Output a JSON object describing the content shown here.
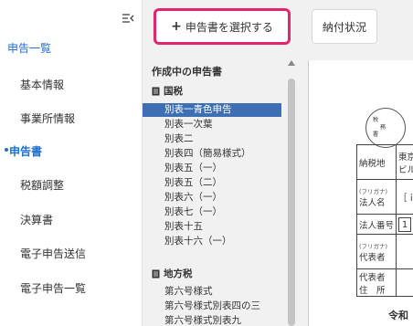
{
  "sidebar": {
    "collapse_icon": "collapse-left-icon",
    "title": "申告一覧",
    "items": [
      {
        "label": "基本情報",
        "active": false
      },
      {
        "label": "事業所情報",
        "active": false
      },
      {
        "label": "申告書",
        "active": true
      },
      {
        "label": "税額調整",
        "active": false
      },
      {
        "label": "決算書",
        "active": false
      },
      {
        "label": "電子申告送信",
        "active": false
      },
      {
        "label": "電子申告一覧",
        "active": false
      }
    ]
  },
  "middle": {
    "select_button": {
      "icon": "plus-icon",
      "label": "申告書を選択する",
      "border_color": "#e2266e"
    },
    "section_title": "作成中の申告書",
    "national_tax": {
      "label": "国税",
      "forms": [
        "別表一青色申告",
        "別表一次葉",
        "別表二",
        "別表四（簡易様式）",
        "別表五（一）",
        "別表五（二）",
        "別表六（一）",
        "別表七（一）",
        "別表十五",
        "別表十六（一）"
      ],
      "selected_index": 0
    },
    "local_tax": {
      "label": "地方税",
      "forms": [
        "第六号様式",
        "第六号様式別表四の三",
        "第六号様式別表九"
      ]
    }
  },
  "right": {
    "tab_label": "納付状況",
    "document": {
      "stamp_chars": [
        "税",
        "務",
        "署",
        "受",
        "付"
      ],
      "rows": [
        {
          "label": "納税地",
          "value": "東京都",
          "value2": "ビル"
        },
        {
          "label_small": "(フリガナ)",
          "label": "法人名",
          "value": "［ｉ"
        },
        {
          "label": "法人番号",
          "value": "1"
        },
        {
          "label_small": "(フリガナ)",
          "label": "代表者"
        },
        {
          "label": "代表者",
          "label2": "住　所"
        }
      ],
      "bottom_label": "令和"
    }
  },
  "colors": {
    "accent": "#1f6fd0",
    "selected_row": "#3f6fb3",
    "highlight_border": "#e2266e"
  }
}
